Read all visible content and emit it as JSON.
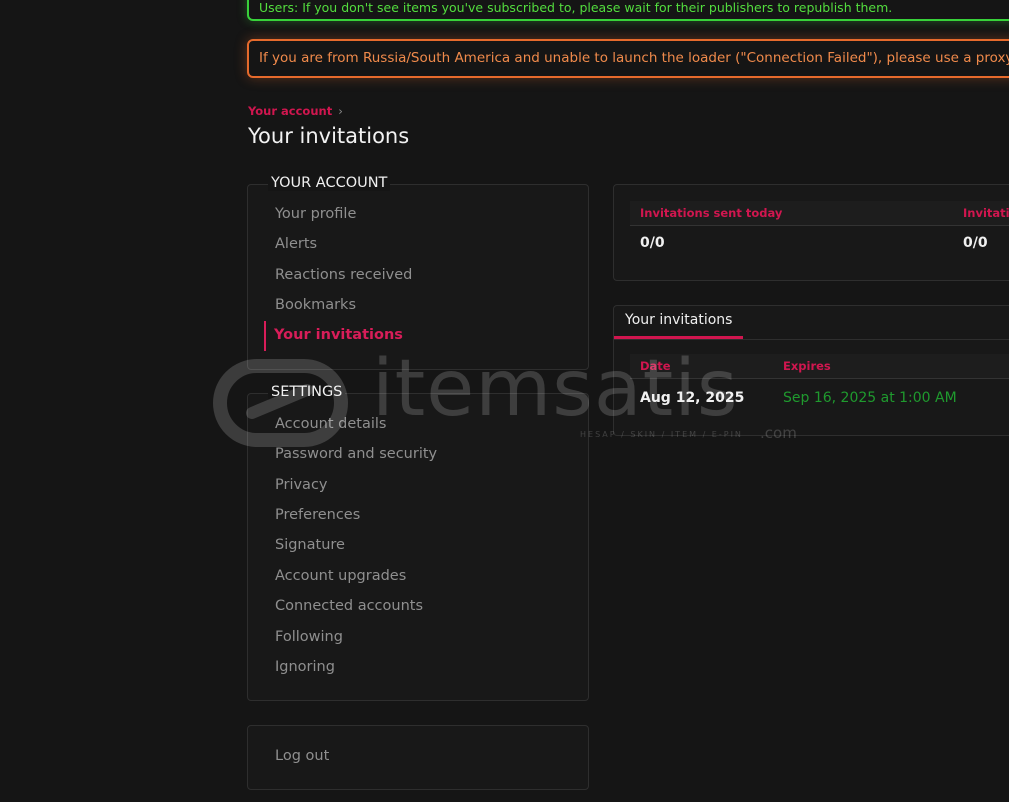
{
  "notices": {
    "green": "Users: If you don't see items you've subscribed to, please wait for their publishers to republish them.",
    "orange": "If you are from Russia/South America and unable to launch the loader (\"Connection Failed\"), please use a proxy"
  },
  "breadcrumb": {
    "label": "Your account",
    "chevron": "›"
  },
  "page_title": "Your invitations",
  "sidebar": {
    "account_heading": "YOUR ACCOUNT",
    "account_items": [
      "Your profile",
      "Alerts",
      "Reactions received",
      "Bookmarks",
      "Your invitations"
    ],
    "active_item": "Your invitations",
    "settings_heading": "SETTINGS",
    "settings_items": [
      "Account details",
      "Password and security",
      "Privacy",
      "Preferences",
      "Signature",
      "Account upgrades",
      "Connected accounts",
      "Following",
      "Ignoring"
    ],
    "logout": "Log out"
  },
  "stats": {
    "headers": [
      "Invitations sent today",
      "Invitatio"
    ],
    "values": [
      "0/0",
      "0/0"
    ]
  },
  "invitations": {
    "tab": "Your invitations",
    "headers": [
      "Date",
      "Expires"
    ],
    "rows": [
      {
        "date": "Aug 12, 2025",
        "expires": "Sep 16, 2025 at 1:00 AM"
      }
    ]
  },
  "watermark": {
    "brand": "itemsatis",
    "tagline": "HESAP / SKIN / ITEM / E-PIN",
    "suffix": ".com"
  },
  "colors": {
    "accent": "#d0164f",
    "green_notice": "#38d23a",
    "orange_notice": "#e66a2c",
    "expires_green": "#1f9a2e",
    "background": "#151515"
  }
}
